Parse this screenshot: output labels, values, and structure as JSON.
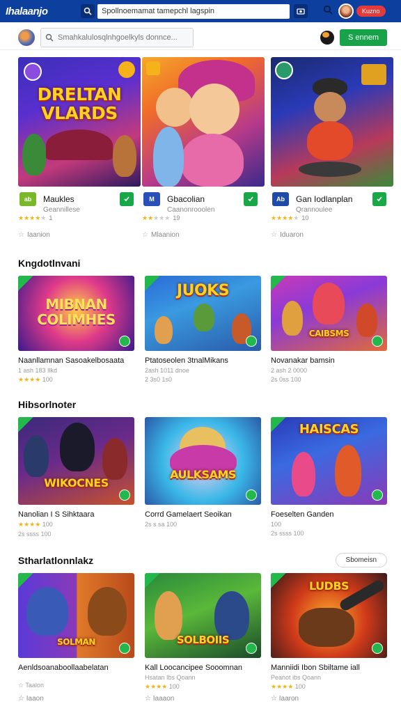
{
  "appbar": {
    "logo": "Ihalaanjo",
    "search_value": "Spollnoemamat tamepchl lagspin",
    "pill_label": "Kuzno"
  },
  "subbar": {
    "search_placeholder": "Smahkalulosqlnhgoelkyls donnce...",
    "green_button": "S ennem"
  },
  "featured": [
    {
      "art_title": "DRELTAN VLARDS",
      "icon_text": "ab",
      "icon_color": "#7ab829",
      "name": "Maukles",
      "subtitle": "Geannillese",
      "rating": "1",
      "count": "Iaanion"
    },
    {
      "art_title": "",
      "icon_text": "M",
      "icon_color": "#2850b8",
      "name": "Gbacolian",
      "subtitle": "Caanonrooolen",
      "rating": "19",
      "count": "Mlaanion"
    },
    {
      "art_title": "",
      "icon_text": "Ab",
      "icon_color": "#1e4ba8",
      "name": "Gan Iodlanplan",
      "subtitle": "Qrannoulee",
      "rating": "10",
      "count": "Iduaron"
    }
  ],
  "sections": [
    {
      "title": "Kngdotlnvani",
      "items": [
        {
          "art_title": "MIBNAN COLIMHES",
          "title": "Naanllamnan Sasoakelbosaata",
          "line1": "1 ash 183 Ilkd",
          "line2": "100"
        },
        {
          "art_title": "JUOKS",
          "title": "Ptatoseolen 3tnalMikans",
          "line1": "2ash 1011 dnoe",
          "line2": "2 3s0 1s0"
        },
        {
          "art_title": "CAIBSMS",
          "title": "Novanakar bamsin",
          "line1": "2 ash 2 0000",
          "line2": "2s 0ss 100"
        }
      ]
    },
    {
      "title": "Hibsorlnoter",
      "items": [
        {
          "art_title": "WIKOCNES",
          "title": "Nanolian I S Sihktaara",
          "line1": "100",
          "line2": "2s ssss 100"
        },
        {
          "art_title": "AULKSAMS",
          "title": "Corrd Gamelaert Seoikan",
          "line1": "",
          "line2": "2s s sa 100"
        },
        {
          "art_title": "HAISCAS",
          "title": "Foeselten Ganden",
          "line1": "100",
          "line2": "2s ssss 100"
        }
      ]
    },
    {
      "title": "Stharlatlonnlakz",
      "see_all": "Sbomeisn",
      "items": [
        {
          "art_title": "SOLMAN",
          "title": "Aenldsoanaboollaabelatan",
          "line1": "Taalon"
        },
        {
          "art_title": "SOLBOIIS",
          "title": "Kall Loocancipee Sooomnan",
          "line1": "Hsatan  Ibs Qoann",
          "line2": "100"
        },
        {
          "art_title": "LUDBS",
          "title": "Manniidi Ibon Sbiltame iall",
          "line1": "Peanot  ibs Qoann",
          "line2": "100"
        }
      ]
    }
  ],
  "footer_counts": [
    "Iaaon",
    "Iaaaon",
    "Iaaron"
  ],
  "colors": {
    "brand_blue": "#0d3f9e",
    "accent_green": "#18a34a",
    "pill_red": "#e23b3b",
    "star": "#f1b516"
  }
}
